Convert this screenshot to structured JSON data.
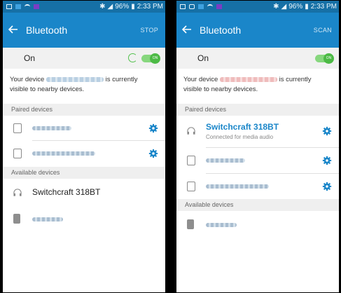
{
  "status": {
    "battery": "96%",
    "time": "2:33 PM"
  },
  "left": {
    "title": "Bluetooth",
    "action": "STOP",
    "on_label": "On",
    "toggle_label": "ON",
    "visible_prefix": "Your device",
    "visible_suffix": "is currently visible to nearby devices.",
    "paired_header": "Paired devices",
    "available_header": "Available devices",
    "available": [
      {
        "name": "Switchcraft 318BT"
      }
    ]
  },
  "right": {
    "title": "Bluetooth",
    "action": "SCAN",
    "on_label": "On",
    "toggle_label": "ON",
    "visible_prefix": "Your device",
    "visible_suffix": "is currently visible to nearby devices.",
    "paired_header": "Paired devices",
    "connected": {
      "name": "Switchcraft 318BT",
      "status": "Connected for media audio"
    },
    "available_header": "Available devices"
  },
  "colors": {
    "accent": "#1a86c9",
    "statusbar": "#1670a6",
    "toggle": "#4cba45",
    "gear": "#1a86c9"
  }
}
